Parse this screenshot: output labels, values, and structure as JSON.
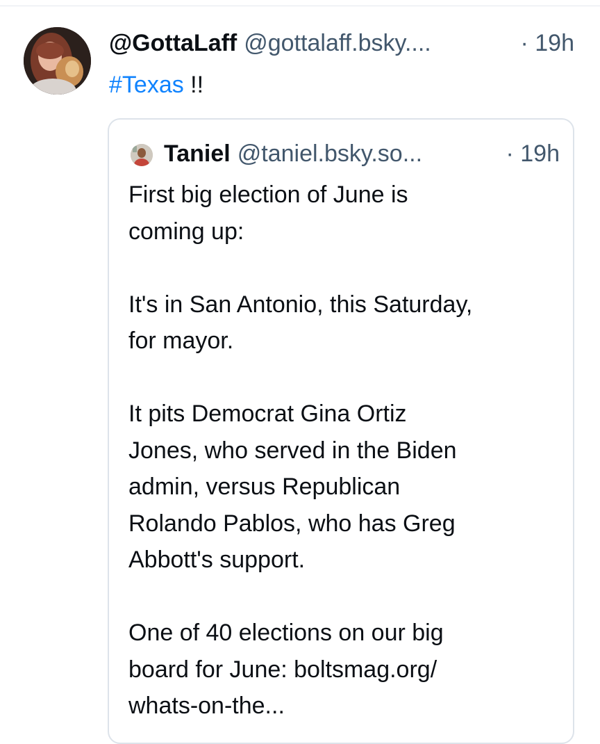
{
  "post": {
    "author": {
      "display_name": "@GottaLaff",
      "handle": "@gottalaff.bsky....",
      "timestamp": "· 19h",
      "avatar_icon": "user-avatar-photo"
    },
    "text": {
      "hashtag": "#Texas",
      "rest": " !!"
    },
    "quote": {
      "author": {
        "display_name": "Taniel",
        "handle": "@taniel.bsky.so...",
        "timestamp": "· 19h",
        "avatar_icon": "user-avatar-photo"
      },
      "paragraphs": [
        "First big election of June is\ncoming up:",
        "It's in San Antonio, this Saturday,\nfor mayor.",
        "It pits Democrat Gina Ortiz\nJones, who served in the Biden\nadmin, versus Republican\nRolando Pablos, who has Greg\nAbbott's support.",
        "One of 40 elections on our big\nboard for June: boltsmag.org/\nwhats-on-the..."
      ]
    }
  },
  "colors": {
    "text": "#0b0f14",
    "muted": "#42576c",
    "link": "#1083fe",
    "border": "#dde3ea"
  }
}
